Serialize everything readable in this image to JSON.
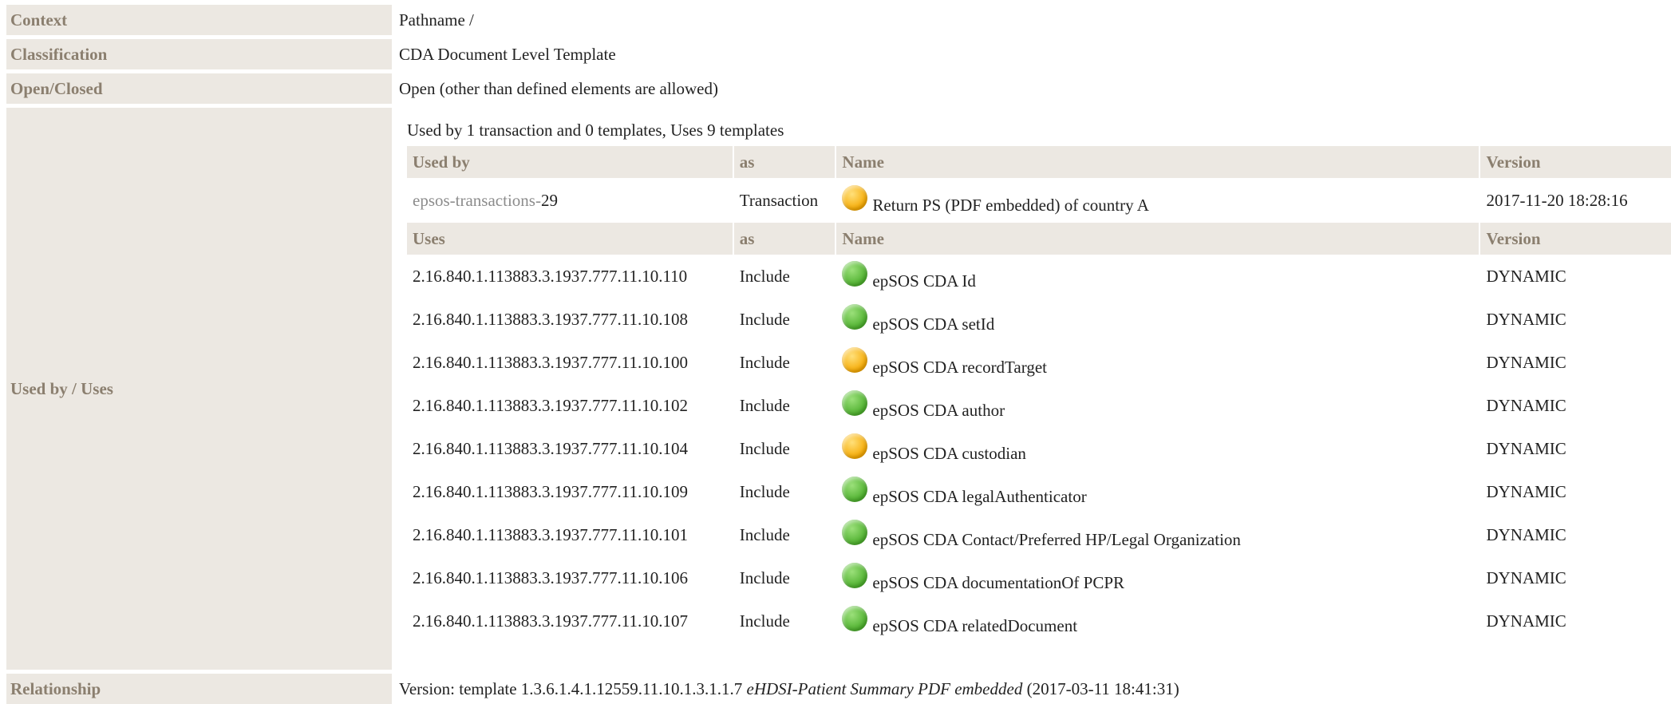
{
  "rows": {
    "context": {
      "label": "Context",
      "value": "Pathname /"
    },
    "classification": {
      "label": "Classification",
      "value": "CDA Document Level Template"
    },
    "open_closed": {
      "label": "Open/Closed",
      "value": "Open (other than defined elements are allowed)"
    },
    "used_by_uses": {
      "label": "Used by / Uses"
    },
    "relationship": {
      "label": "Relationship",
      "prefix": "Version: template 1.3.6.1.4.1.12559.11.10.1.3.1.1.7",
      "name": "eHDSI-Patient Summary PDF embedded",
      "date": "(2017-03-11 18:41:31)"
    }
  },
  "usage": {
    "summary": "Used by 1 transaction and 0 templates, Uses 9 templates",
    "used_by_headers": [
      "Used by",
      "as",
      "Name",
      "Version"
    ],
    "used_by": [
      {
        "ref_prefix": "epsos-transactions-",
        "ref_num": "29",
        "as": "Transaction",
        "status": "orange",
        "name": "Return PS (PDF embedded) of country A",
        "version": "2017-11-20 18:28:16"
      }
    ],
    "uses_headers": [
      "Uses",
      "as",
      "Name",
      "Version"
    ],
    "uses": [
      {
        "id": "2.16.840.1.113883.3.1937.777.11.10.110",
        "as": "Include",
        "status": "green",
        "name": "epSOS CDA Id",
        "version": "DYNAMIC"
      },
      {
        "id": "2.16.840.1.113883.3.1937.777.11.10.108",
        "as": "Include",
        "status": "green",
        "name": "epSOS CDA setId",
        "version": "DYNAMIC"
      },
      {
        "id": "2.16.840.1.113883.3.1937.777.11.10.100",
        "as": "Include",
        "status": "orange",
        "name": "epSOS CDA recordTarget",
        "version": "DYNAMIC"
      },
      {
        "id": "2.16.840.1.113883.3.1937.777.11.10.102",
        "as": "Include",
        "status": "green",
        "name": "epSOS CDA author",
        "version": "DYNAMIC"
      },
      {
        "id": "2.16.840.1.113883.3.1937.777.11.10.104",
        "as": "Include",
        "status": "orange",
        "name": "epSOS CDA custodian",
        "version": "DYNAMIC"
      },
      {
        "id": "2.16.840.1.113883.3.1937.777.11.10.109",
        "as": "Include",
        "status": "green",
        "name": "epSOS CDA legalAuthenticator",
        "version": "DYNAMIC"
      },
      {
        "id": "2.16.840.1.113883.3.1937.777.11.10.101",
        "as": "Include",
        "status": "green",
        "name": "epSOS CDA Contact/Preferred HP/Legal Organization",
        "version": "DYNAMIC"
      },
      {
        "id": "2.16.840.1.113883.3.1937.777.11.10.106",
        "as": "Include",
        "status": "green",
        "name": "epSOS CDA documentationOf PCPR",
        "version": "DYNAMIC"
      },
      {
        "id": "2.16.840.1.113883.3.1937.777.11.10.107",
        "as": "Include",
        "status": "green",
        "name": "epSOS CDA relatedDocument",
        "version": "DYNAMIC"
      }
    ]
  },
  "colors": {
    "label_bg": "#ece8e2",
    "label_text": "#8b7f6f",
    "status_green": "#4caf2c",
    "status_orange": "#f5a800"
  }
}
